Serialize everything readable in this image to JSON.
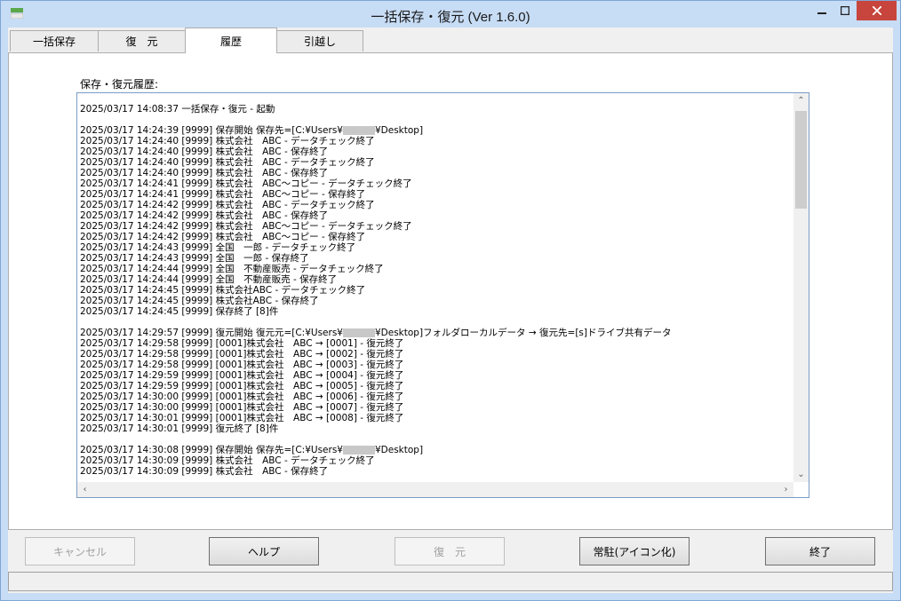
{
  "window": {
    "title": "一括保存・復元 (Ver 1.6.0)",
    "icons": {
      "app": "app-icon",
      "minimize": "minimize-icon",
      "maximize": "maximize-icon",
      "close": "close-icon"
    }
  },
  "tabs": [
    {
      "label": "一括保存"
    },
    {
      "label": "復　元"
    },
    {
      "label": "履歴"
    },
    {
      "label": "引越し"
    }
  ],
  "history": {
    "label": "保存・復元履歴:",
    "lines": [
      "2025/03/17 14:08:37 一括保存・復元 - 起動",
      "",
      "2025/03/17 14:24:39 [9999] 保存開始 保存先=[C:¥Users¥▒¥Desktop]",
      "2025/03/17 14:24:40 [9999] 株式会社　ABC - データチェック終了",
      "2025/03/17 14:24:40 [9999] 株式会社　ABC - 保存終了",
      "2025/03/17 14:24:40 [9999] 株式会社　ABC - データチェック終了",
      "2025/03/17 14:24:40 [9999] 株式会社　ABC - 保存終了",
      "2025/03/17 14:24:41 [9999] 株式会社　ABC～コピー - データチェック終了",
      "2025/03/17 14:24:41 [9999] 株式会社　ABC～コピー - 保存終了",
      "2025/03/17 14:24:42 [9999] 株式会社　ABC - データチェック終了",
      "2025/03/17 14:24:42 [9999] 株式会社　ABC - 保存終了",
      "2025/03/17 14:24:42 [9999] 株式会社　ABC～コピー - データチェック終了",
      "2025/03/17 14:24:42 [9999] 株式会社　ABC～コピー - 保存終了",
      "2025/03/17 14:24:43 [9999] 全国　一郎 - データチェック終了",
      "2025/03/17 14:24:43 [9999] 全国　一郎 - 保存終了",
      "2025/03/17 14:24:44 [9999] 全国　不動産販売 - データチェック終了",
      "2025/03/17 14:24:44 [9999] 全国　不動産販売 - 保存終了",
      "2025/03/17 14:24:45 [9999] 株式会社ABC - データチェック終了",
      "2025/03/17 14:24:45 [9999] 株式会社ABC - 保存終了",
      "2025/03/17 14:24:45 [9999] 保存終了 [8]件",
      "",
      "2025/03/17 14:29:57 [9999] 復元開始 復元元=[C:¥Users¥▒¥Desktop]フォルダローカルデータ → 復元先=[s]ドライブ共有データ",
      "2025/03/17 14:29:58 [9999] [0001]株式会社　ABC → [0001] - 復元終了",
      "2025/03/17 14:29:58 [9999] [0001]株式会社　ABC → [0002] - 復元終了",
      "2025/03/17 14:29:58 [9999] [0001]株式会社　ABC → [0003] - 復元終了",
      "2025/03/17 14:29:59 [9999] [0001]株式会社　ABC → [0004] - 復元終了",
      "2025/03/17 14:29:59 [9999] [0001]株式会社　ABC → [0005] - 復元終了",
      "2025/03/17 14:30:00 [9999] [0001]株式会社　ABC → [0006] - 復元終了",
      "2025/03/17 14:30:00 [9999] [0001]株式会社　ABC → [0007] - 復元終了",
      "2025/03/17 14:30:01 [9999] [0001]株式会社　ABC → [0008] - 復元終了",
      "2025/03/17 14:30:01 [9999] 復元終了 [8]件",
      "",
      "2025/03/17 14:30:08 [9999] 保存開始 保存先=[C:¥Users¥▒¥Desktop]",
      "2025/03/17 14:30:09 [9999] 株式会社　ABC - データチェック終了",
      "2025/03/17 14:30:09 [9999] 株式会社　ABC - 保存終了"
    ]
  },
  "buttons": {
    "cancel": "キャンセル",
    "help": "ヘルプ",
    "restore": "復　元",
    "resident": "常駐(アイコン化)",
    "exit": "終了"
  }
}
